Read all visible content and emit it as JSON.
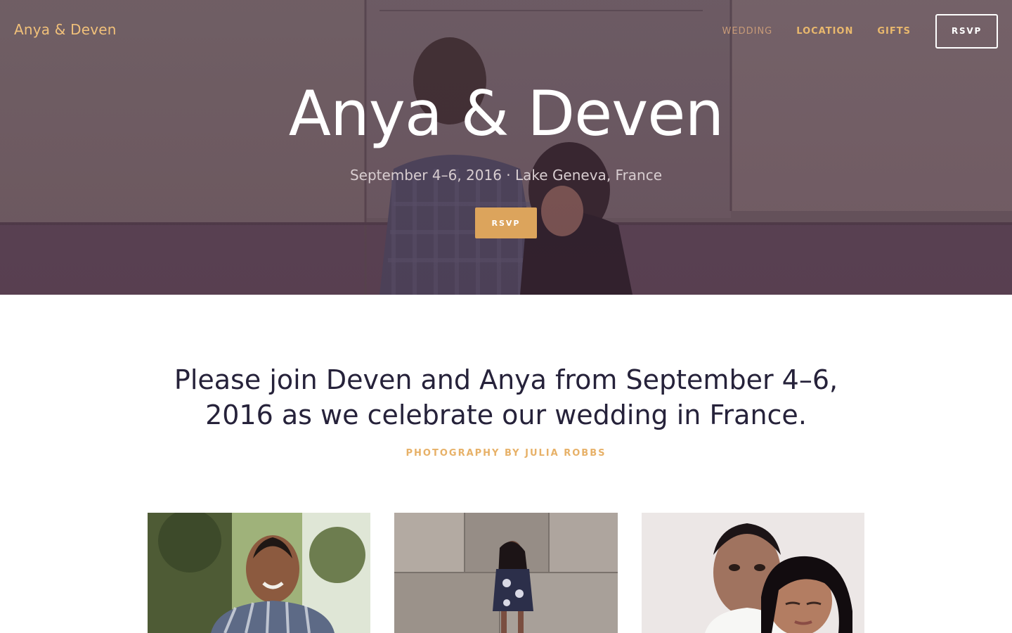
{
  "brand": "Anya & Deven",
  "nav": {
    "items": [
      {
        "label": "WEDDING"
      },
      {
        "label": "LOCATION"
      },
      {
        "label": "GIFTS"
      }
    ],
    "rsvp_label": "RSVP"
  },
  "hero": {
    "title": "Anya & Deven",
    "subtitle": "September 4–6, 2016 · Lake Geneva, France",
    "button_label": "RSVP"
  },
  "intro": {
    "text": "Please join Deven and Anya from September 4–6, 2016 as we celebrate our wedding in France.",
    "credit": "PHOTOGRAPHY BY JULIA ROBBS"
  },
  "colors": {
    "accent": "#dca45c",
    "nav_link": "#e9b86d",
    "heading_text": "#26223a"
  },
  "gallery": [
    {
      "alt": "portrait-man-outdoors"
    },
    {
      "alt": "woman-stone-wall"
    },
    {
      "alt": "couple-closeup"
    }
  ]
}
